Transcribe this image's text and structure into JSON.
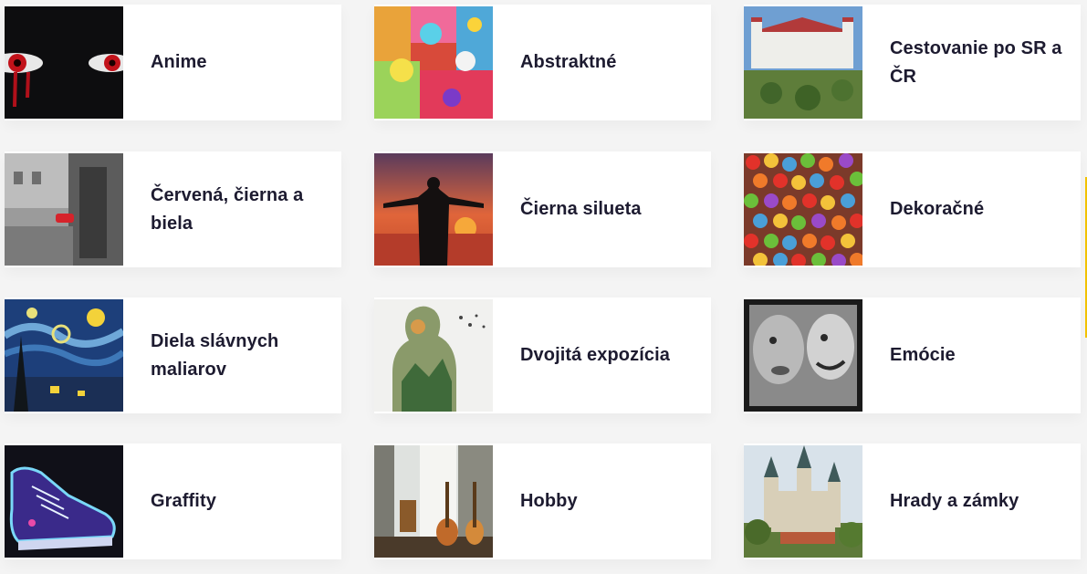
{
  "categories": [
    {
      "label": "Anime",
      "thumb_icon": "anime-eyes-image"
    },
    {
      "label": "Abstraktné",
      "thumb_icon": "abstract-balloons-image"
    },
    {
      "label": "Cestovanie po SR a ČR",
      "thumb_icon": "castle-travel-image"
    },
    {
      "label": "Červená, čierna a biela",
      "thumb_icon": "street-red-car-image"
    },
    {
      "label": "Čierna silueta",
      "thumb_icon": "silhouette-sunset-image"
    },
    {
      "label": "Dekoračné",
      "thumb_icon": "candy-decorative-image"
    },
    {
      "label": "Diela slávnych maliarov",
      "thumb_icon": "starry-night-image"
    },
    {
      "label": "Dvojitá expozícia",
      "thumb_icon": "double-exposure-image"
    },
    {
      "label": "Emócie",
      "thumb_icon": "emotions-bw-image"
    },
    {
      "label": "Graffity",
      "thumb_icon": "graffiti-sneaker-image"
    },
    {
      "label": "Hobby",
      "thumb_icon": "guitars-hobby-image"
    },
    {
      "label": "Hrady a zámky",
      "thumb_icon": "castle-hrady-image"
    }
  ],
  "colors": {
    "text": "#1d1b30",
    "card": "#ffffff",
    "background": "#f4f4f4",
    "edge_accent": "#f2c200"
  }
}
